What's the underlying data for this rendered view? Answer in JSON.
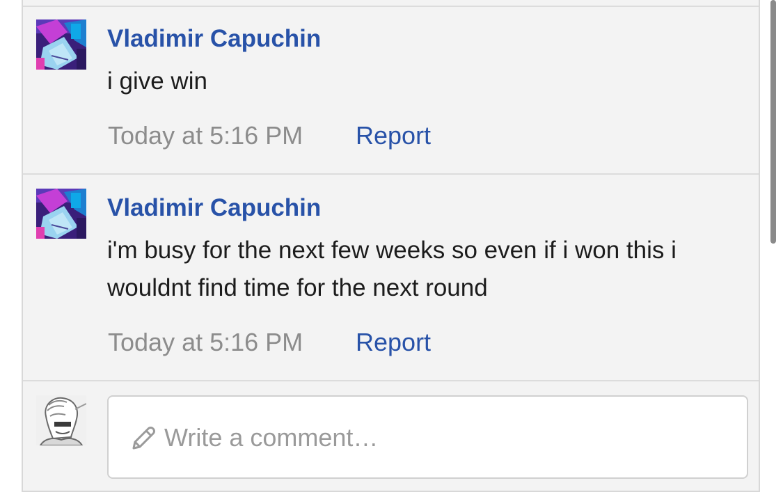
{
  "comments": [
    {
      "author": "Vladimir Capuchin",
      "avatar_icon": "author-avatar-icon",
      "text": "i give win",
      "time": "Today at 5:16 PM",
      "report_label": "Report"
    },
    {
      "author": "Vladimir Capuchin",
      "avatar_icon": "author-avatar-icon",
      "text": "i'm busy for the next few weeks so even if i won this i wouldnt find time for the next round",
      "time": "Today at 5:16 PM",
      "report_label": "Report"
    }
  ],
  "composer": {
    "placeholder": "Write a comment…",
    "icon": "pencil-icon",
    "avatar_icon": "current-user-avatar-icon"
  },
  "colors": {
    "link": "#2852a8",
    "meta": "#8c8c8c",
    "panel_background": "#f3f3f3",
    "text": "#1c1c1c"
  }
}
